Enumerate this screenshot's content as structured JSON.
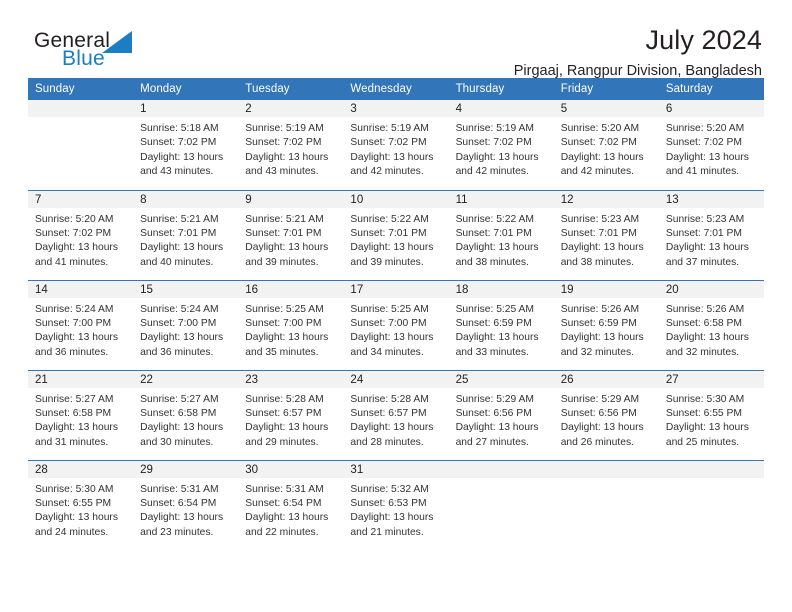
{
  "brand": {
    "word1": "General",
    "word2": "Blue",
    "accent_color": "#1b7ec2",
    "triangle_icon": "triangle-icon"
  },
  "header": {
    "title": "July 2024",
    "subtitle": "Pirgaaj, Rangpur Division, Bangladesh"
  },
  "calendar": {
    "header_color": "#3275b8",
    "daynum_bg": "#f2f2f2",
    "weekday_headers": [
      "Sunday",
      "Monday",
      "Tuesday",
      "Wednesday",
      "Thursday",
      "Friday",
      "Saturday"
    ],
    "weeks": [
      [
        {
          "day": "",
          "lines": []
        },
        {
          "day": "1",
          "lines": [
            "Sunrise: 5:18 AM",
            "Sunset: 7:02 PM",
            "Daylight: 13 hours",
            "and 43 minutes."
          ]
        },
        {
          "day": "2",
          "lines": [
            "Sunrise: 5:19 AM",
            "Sunset: 7:02 PM",
            "Daylight: 13 hours",
            "and 43 minutes."
          ]
        },
        {
          "day": "3",
          "lines": [
            "Sunrise: 5:19 AM",
            "Sunset: 7:02 PM",
            "Daylight: 13 hours",
            "and 42 minutes."
          ]
        },
        {
          "day": "4",
          "lines": [
            "Sunrise: 5:19 AM",
            "Sunset: 7:02 PM",
            "Daylight: 13 hours",
            "and 42 minutes."
          ]
        },
        {
          "day": "5",
          "lines": [
            "Sunrise: 5:20 AM",
            "Sunset: 7:02 PM",
            "Daylight: 13 hours",
            "and 42 minutes."
          ]
        },
        {
          "day": "6",
          "lines": [
            "Sunrise: 5:20 AM",
            "Sunset: 7:02 PM",
            "Daylight: 13 hours",
            "and 41 minutes."
          ]
        }
      ],
      [
        {
          "day": "7",
          "lines": [
            "Sunrise: 5:20 AM",
            "Sunset: 7:02 PM",
            "Daylight: 13 hours",
            "and 41 minutes."
          ]
        },
        {
          "day": "8",
          "lines": [
            "Sunrise: 5:21 AM",
            "Sunset: 7:01 PM",
            "Daylight: 13 hours",
            "and 40 minutes."
          ]
        },
        {
          "day": "9",
          "lines": [
            "Sunrise: 5:21 AM",
            "Sunset: 7:01 PM",
            "Daylight: 13 hours",
            "and 39 minutes."
          ]
        },
        {
          "day": "10",
          "lines": [
            "Sunrise: 5:22 AM",
            "Sunset: 7:01 PM",
            "Daylight: 13 hours",
            "and 39 minutes."
          ]
        },
        {
          "day": "11",
          "lines": [
            "Sunrise: 5:22 AM",
            "Sunset: 7:01 PM",
            "Daylight: 13 hours",
            "and 38 minutes."
          ]
        },
        {
          "day": "12",
          "lines": [
            "Sunrise: 5:23 AM",
            "Sunset: 7:01 PM",
            "Daylight: 13 hours",
            "and 38 minutes."
          ]
        },
        {
          "day": "13",
          "lines": [
            "Sunrise: 5:23 AM",
            "Sunset: 7:01 PM",
            "Daylight: 13 hours",
            "and 37 minutes."
          ]
        }
      ],
      [
        {
          "day": "14",
          "lines": [
            "Sunrise: 5:24 AM",
            "Sunset: 7:00 PM",
            "Daylight: 13 hours",
            "and 36 minutes."
          ]
        },
        {
          "day": "15",
          "lines": [
            "Sunrise: 5:24 AM",
            "Sunset: 7:00 PM",
            "Daylight: 13 hours",
            "and 36 minutes."
          ]
        },
        {
          "day": "16",
          "lines": [
            "Sunrise: 5:25 AM",
            "Sunset: 7:00 PM",
            "Daylight: 13 hours",
            "and 35 minutes."
          ]
        },
        {
          "day": "17",
          "lines": [
            "Sunrise: 5:25 AM",
            "Sunset: 7:00 PM",
            "Daylight: 13 hours",
            "and 34 minutes."
          ]
        },
        {
          "day": "18",
          "lines": [
            "Sunrise: 5:25 AM",
            "Sunset: 6:59 PM",
            "Daylight: 13 hours",
            "and 33 minutes."
          ]
        },
        {
          "day": "19",
          "lines": [
            "Sunrise: 5:26 AM",
            "Sunset: 6:59 PM",
            "Daylight: 13 hours",
            "and 32 minutes."
          ]
        },
        {
          "day": "20",
          "lines": [
            "Sunrise: 5:26 AM",
            "Sunset: 6:58 PM",
            "Daylight: 13 hours",
            "and 32 minutes."
          ]
        }
      ],
      [
        {
          "day": "21",
          "lines": [
            "Sunrise: 5:27 AM",
            "Sunset: 6:58 PM",
            "Daylight: 13 hours",
            "and 31 minutes."
          ]
        },
        {
          "day": "22",
          "lines": [
            "Sunrise: 5:27 AM",
            "Sunset: 6:58 PM",
            "Daylight: 13 hours",
            "and 30 minutes."
          ]
        },
        {
          "day": "23",
          "lines": [
            "Sunrise: 5:28 AM",
            "Sunset: 6:57 PM",
            "Daylight: 13 hours",
            "and 29 minutes."
          ]
        },
        {
          "day": "24",
          "lines": [
            "Sunrise: 5:28 AM",
            "Sunset: 6:57 PM",
            "Daylight: 13 hours",
            "and 28 minutes."
          ]
        },
        {
          "day": "25",
          "lines": [
            "Sunrise: 5:29 AM",
            "Sunset: 6:56 PM",
            "Daylight: 13 hours",
            "and 27 minutes."
          ]
        },
        {
          "day": "26",
          "lines": [
            "Sunrise: 5:29 AM",
            "Sunset: 6:56 PM",
            "Daylight: 13 hours",
            "and 26 minutes."
          ]
        },
        {
          "day": "27",
          "lines": [
            "Sunrise: 5:30 AM",
            "Sunset: 6:55 PM",
            "Daylight: 13 hours",
            "and 25 minutes."
          ]
        }
      ],
      [
        {
          "day": "28",
          "lines": [
            "Sunrise: 5:30 AM",
            "Sunset: 6:55 PM",
            "Daylight: 13 hours",
            "and 24 minutes."
          ]
        },
        {
          "day": "29",
          "lines": [
            "Sunrise: 5:31 AM",
            "Sunset: 6:54 PM",
            "Daylight: 13 hours",
            "and 23 minutes."
          ]
        },
        {
          "day": "30",
          "lines": [
            "Sunrise: 5:31 AM",
            "Sunset: 6:54 PM",
            "Daylight: 13 hours",
            "and 22 minutes."
          ]
        },
        {
          "day": "31",
          "lines": [
            "Sunrise: 5:32 AM",
            "Sunset: 6:53 PM",
            "Daylight: 13 hours",
            "and 21 minutes."
          ]
        },
        {
          "day": "",
          "lines": []
        },
        {
          "day": "",
          "lines": []
        },
        {
          "day": "",
          "lines": []
        }
      ]
    ]
  }
}
